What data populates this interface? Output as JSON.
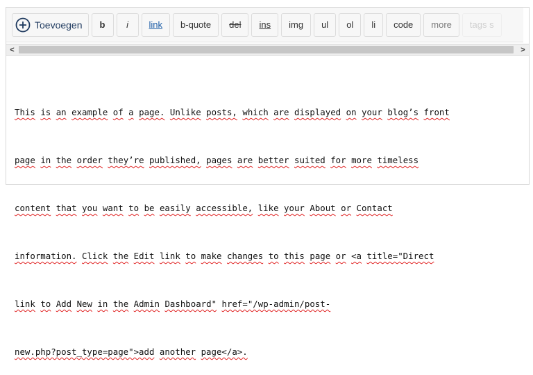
{
  "toolbar": {
    "add_label": "Toevoegen",
    "add_icon": "plus-circle-icon",
    "buttons": [
      {
        "label": "b"
      },
      {
        "label": "i"
      },
      {
        "label": "link"
      },
      {
        "label": "b-quote"
      },
      {
        "label": "del"
      },
      {
        "label": "ins"
      },
      {
        "label": "img"
      },
      {
        "label": "ul"
      },
      {
        "label": "ol"
      },
      {
        "label": "li"
      },
      {
        "label": "code"
      },
      {
        "label": "more"
      },
      {
        "label": "tags s"
      }
    ]
  },
  "scrollbar": {
    "left_arrow": "<",
    "right_arrow": ">"
  },
  "content": {
    "lines": [
      "This is an example of a page. Unlike posts, which are displayed on your blog’s front",
      "page in the order they’re published, pages are better suited for more timeless",
      "content that you want to be easily accessible, like your About or Contact",
      "information. Click the Edit link to make changes to this page or <a title=\"Direct",
      "link to Add New in the Admin Dashboard\" href=\"/wp-admin/post-",
      "new.php?post_type=page\">add another page</a>."
    ],
    "misspelled_color": "#e02020"
  }
}
